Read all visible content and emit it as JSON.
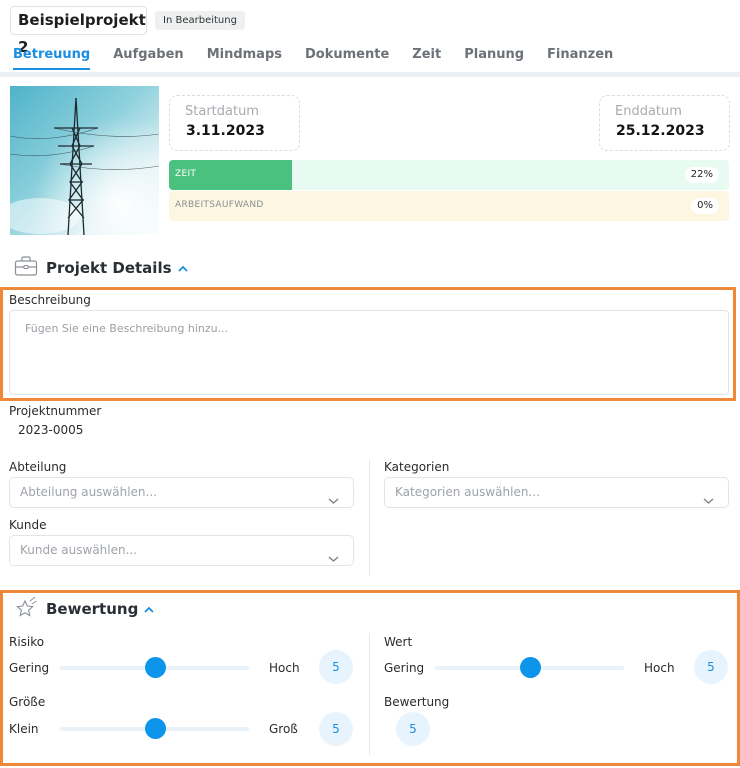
{
  "header": {
    "project_title": "Beispielprojekt 2",
    "status": "In Bearbeitung"
  },
  "tabs": [
    {
      "label": "Betreuung",
      "active": true
    },
    {
      "label": "Aufgaben"
    },
    {
      "label": "Mindmaps"
    },
    {
      "label": "Dokumente"
    },
    {
      "label": "Zeit"
    },
    {
      "label": "Planung"
    },
    {
      "label": "Finanzen"
    }
  ],
  "dates": {
    "start_label": "Startdatum",
    "start_value": "3.11.2023",
    "end_label": "Enddatum",
    "end_value": "25.12.2023"
  },
  "progress": [
    {
      "label": "ZEIT",
      "percent_text": "22%",
      "fraction": 0.22,
      "track_color": "#e8fbf3",
      "fill_color": "#4ac17e"
    },
    {
      "label": "ARBEITSAUFWAND",
      "percent_text": "0%",
      "fraction": 0.0,
      "track_color": "#fdf6e1",
      "fill_color": "#f2c94c"
    }
  ],
  "project_details": {
    "title": "Projekt Details",
    "description_label": "Beschreibung",
    "description_placeholder": "Fügen Sie eine Beschreibung hinzu...",
    "project_number_label": "Projektnummer",
    "project_number": "2023-0005",
    "department_label": "Abteilung",
    "department_placeholder": "Abteilung auswählen...",
    "customer_label": "Kunde",
    "customer_placeholder": "Kunde auswählen...",
    "categories_label": "Kategorien",
    "categories_placeholder": "Kategorien auswählen..."
  },
  "rating": {
    "title": "Bewertung",
    "risk": {
      "label": "Risiko",
      "low": "Gering",
      "high": "Hoch",
      "value": "5",
      "level": 0.5
    },
    "size": {
      "label": "Größe",
      "low": "Klein",
      "high": "Groß",
      "value": "5",
      "level": 0.5
    },
    "worth": {
      "label": "Wert",
      "low": "Gering",
      "high": "Hoch",
      "value": "5",
      "level": 0.5
    },
    "overall": {
      "label": "Bewertung",
      "value": "5"
    }
  },
  "colors": {
    "accent": "#1a8ee0",
    "highlight": "#f0883a",
    "slider_thumb": "#0c95ea"
  }
}
